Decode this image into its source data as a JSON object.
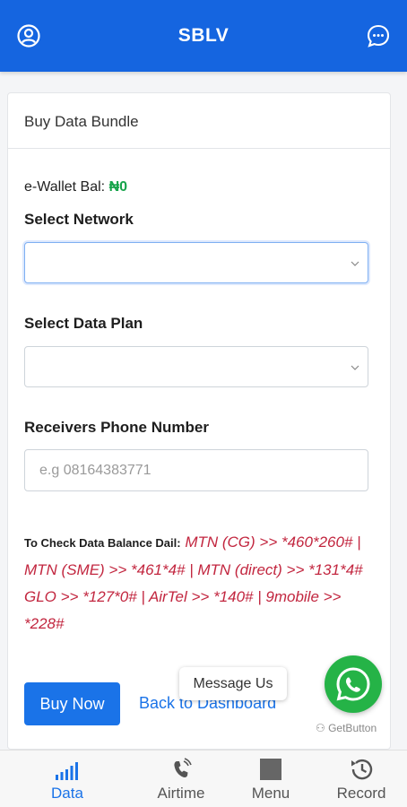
{
  "header": {
    "title": "SBLV"
  },
  "card": {
    "title": "Buy Data Bundle",
    "wallet_label": "e-Wallet Bal:",
    "wallet_amount": "₦0",
    "network_label": "Select Network",
    "plan_label": "Select Data Plan",
    "phone_label": "Receivers Phone Number",
    "phone_placeholder": "e.g 08164383771",
    "info_label": "To Check Data Balance Dail:",
    "info_text_1": " MTN (CG) >> *460*260# | MTN (SME) >> *461*4# | MTN (direct) >> *131*4#",
    "info_text_2": "GLO >> *127*0# | AirTel >> *140# | 9mobile >> *228#",
    "buy_button": "Buy Now",
    "back_link": "Back to Dashboard"
  },
  "whatsapp": {
    "tooltip": "Message Us",
    "credit": "GetButton"
  },
  "nav": {
    "items": [
      {
        "label": "Data",
        "icon": "signal-bars-icon",
        "active": true
      },
      {
        "label": "Airtime",
        "icon": "phone-ring-icon",
        "active": false
      },
      {
        "label": "Menu",
        "icon": "square-icon",
        "active": false
      },
      {
        "label": "Record",
        "icon": "history-icon",
        "active": false
      }
    ]
  },
  "colors": {
    "primary": "#1565e0",
    "wallet_amount": "#16a34a",
    "info_text": "#c2263f",
    "whatsapp": "#25b347"
  }
}
